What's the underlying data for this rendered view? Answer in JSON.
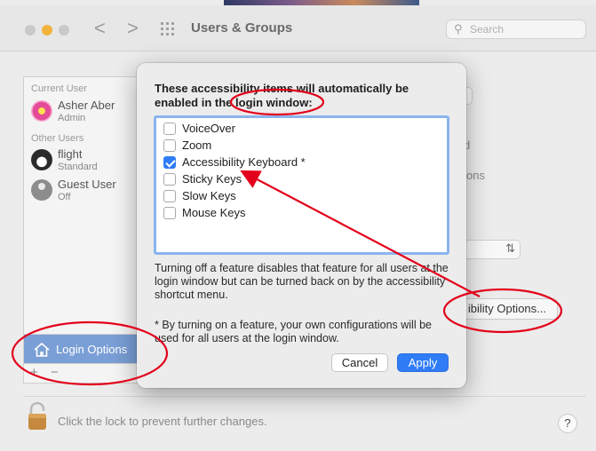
{
  "window": {
    "title": "Users & Groups",
    "search_placeholder": "Search",
    "back_glyph": "<",
    "forward_glyph": ">"
  },
  "sidebar": {
    "current_user_header": "Current User",
    "other_users_header": "Other Users",
    "users": [
      {
        "name": "Asher Aber",
        "role": "Admin",
        "avatar": "flower"
      },
      {
        "name": "flight",
        "role": "Standard",
        "avatar": "penguin"
      },
      {
        "name": "Guest User",
        "role": "Off",
        "avatar": "silhouette"
      }
    ],
    "login_options_label": "Login Options",
    "add_glyph": "+",
    "remove_glyph": "−"
  },
  "background_fragments": {
    "ons_text": "ons",
    "d_text": "d",
    "accessibility_options_button": "ibility Options...",
    "lock_text": "Click the lock to prevent further changes.",
    "help_glyph": "?",
    "popup_chevron": "⌃⌄"
  },
  "dialog": {
    "heading": "These accessibility items will automatically be enabled in the login window:",
    "items": [
      {
        "label": "VoiceOver",
        "checked": false
      },
      {
        "label": "Zoom",
        "checked": false
      },
      {
        "label": "Accessibility Keyboard *",
        "checked": true
      },
      {
        "label": "Sticky Keys",
        "checked": false
      },
      {
        "label": "Slow Keys",
        "checked": false
      },
      {
        "label": "Mouse Keys",
        "checked": false
      }
    ],
    "note1": "Turning off a feature disables that feature for all users at the login window but can be turned back on by the accessibility shortcut menu.",
    "note2": "* By turning on a feature, your own configurations will be used for all users at the login window.",
    "cancel_label": "Cancel",
    "apply_label": "Apply"
  },
  "colors": {
    "accent": "#2f7cf6",
    "annotation": "#e3001b",
    "selected_sidebar": "#7a9fd6"
  }
}
